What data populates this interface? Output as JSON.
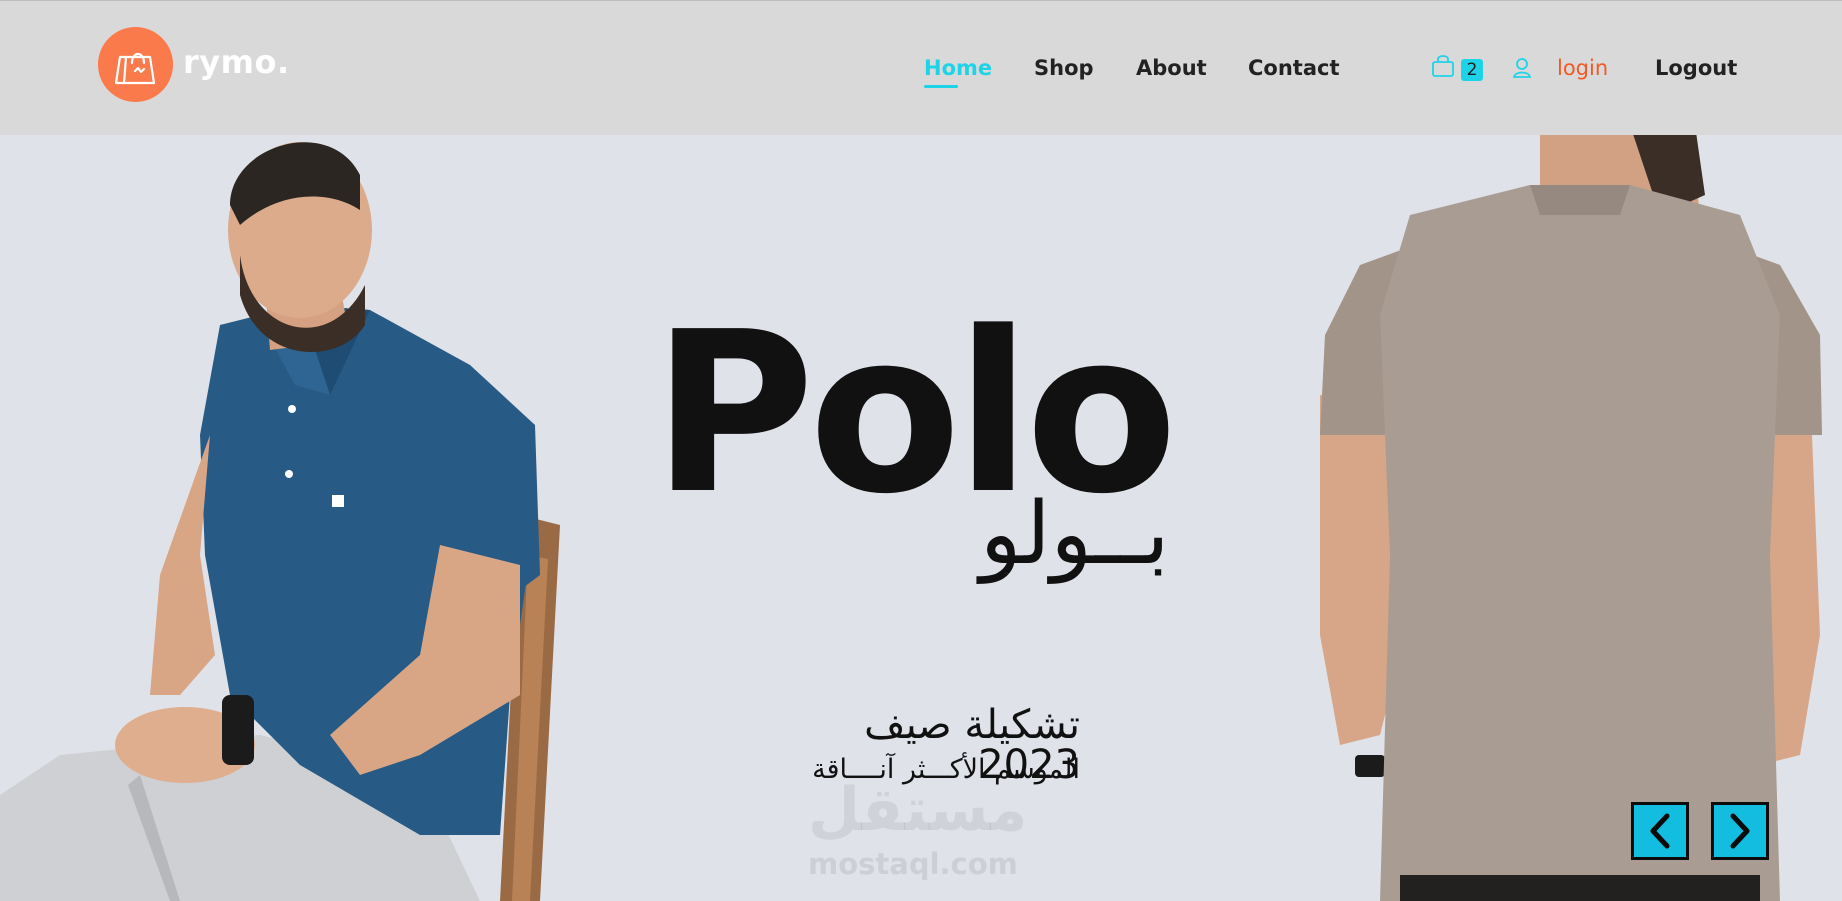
{
  "app": {
    "logo_text": "rymo.",
    "logo_icon": "shopping-bag-icon",
    "brand_color": "#fb7a4c",
    "accent_color": "#1ed3e8",
    "login_color": "#f15a24"
  },
  "nav": {
    "items": [
      {
        "label": "Home",
        "active": true
      },
      {
        "label": "Shop",
        "active": false
      },
      {
        "label": "About",
        "active": false
      },
      {
        "label": "Contact",
        "active": false
      }
    ],
    "cart_icon": "shopping-bag-icon",
    "cart_count": "2",
    "user_icon": "user-icon",
    "login_label": "login",
    "logout_label": "Logout"
  },
  "hero": {
    "title": "Polo",
    "title_arabic": "بــولو",
    "collection_title": "تشكيلة صيف 2023",
    "collection_subtitle": "الموسم الأكـــثر آنــــاقة",
    "watermark_arabic": "مستقل",
    "watermark_url": "mostaql.com",
    "prev_icon": "chevron-left-icon",
    "next_icon": "chevron-right-icon",
    "left_model_image": "man-seated-blue-polo",
    "right_model_image": "man-back-gray-polo"
  }
}
